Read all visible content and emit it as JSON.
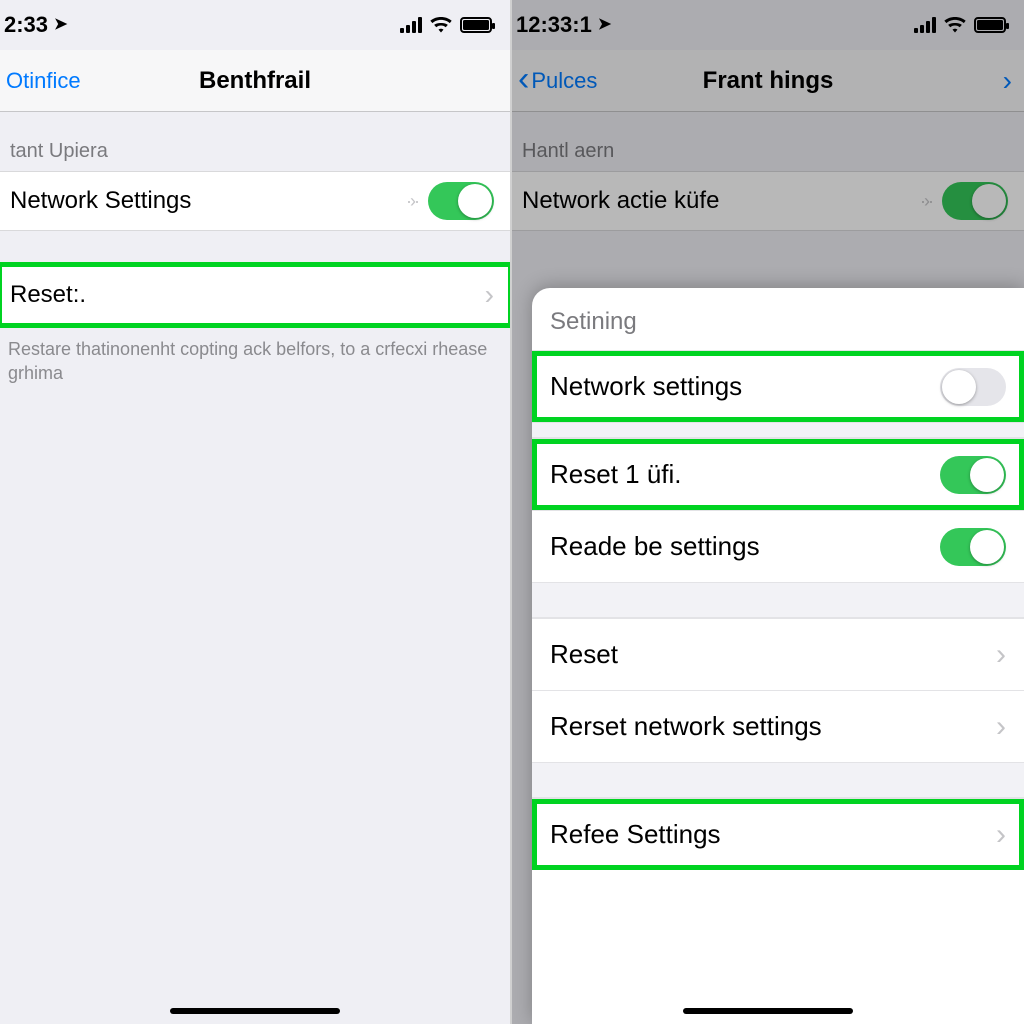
{
  "colors": {
    "accent": "#007aff",
    "toggle_on": "#34c759",
    "highlight": "#00d321"
  },
  "left": {
    "status_time": "2:33",
    "nav_back": "Otinfice",
    "nav_title": "Benthfrail",
    "group1_header": "tant Upiera",
    "row_network": "Network Settings",
    "row_network_toggle": true,
    "row_reset": "Reset:.",
    "footer": "Restare thatinonenht copting ack belfors, to a crfecxi rhease grhima"
  },
  "right": {
    "status_time": "12:33:1",
    "nav_back": "Pulces",
    "nav_title": "Frant hings",
    "group1_header": "Hantl aern",
    "row_network": "Network actie küfe",
    "row_network_toggle": true,
    "sheet": {
      "title": "Setining",
      "rows": [
        {
          "label": "Network settings",
          "type": "toggle",
          "on": false,
          "hl": true
        },
        {
          "label": "Reset 1 üfi.",
          "type": "toggle",
          "on": true,
          "hl": true
        },
        {
          "label": "Reade be settings",
          "type": "toggle",
          "on": true,
          "hl": false
        },
        {
          "label": "Reset",
          "type": "nav",
          "hl": false
        },
        {
          "label": "Rerset network settings",
          "type": "nav",
          "hl": false
        },
        {
          "label": "Refee Settings",
          "type": "nav",
          "hl": true
        }
      ]
    }
  }
}
